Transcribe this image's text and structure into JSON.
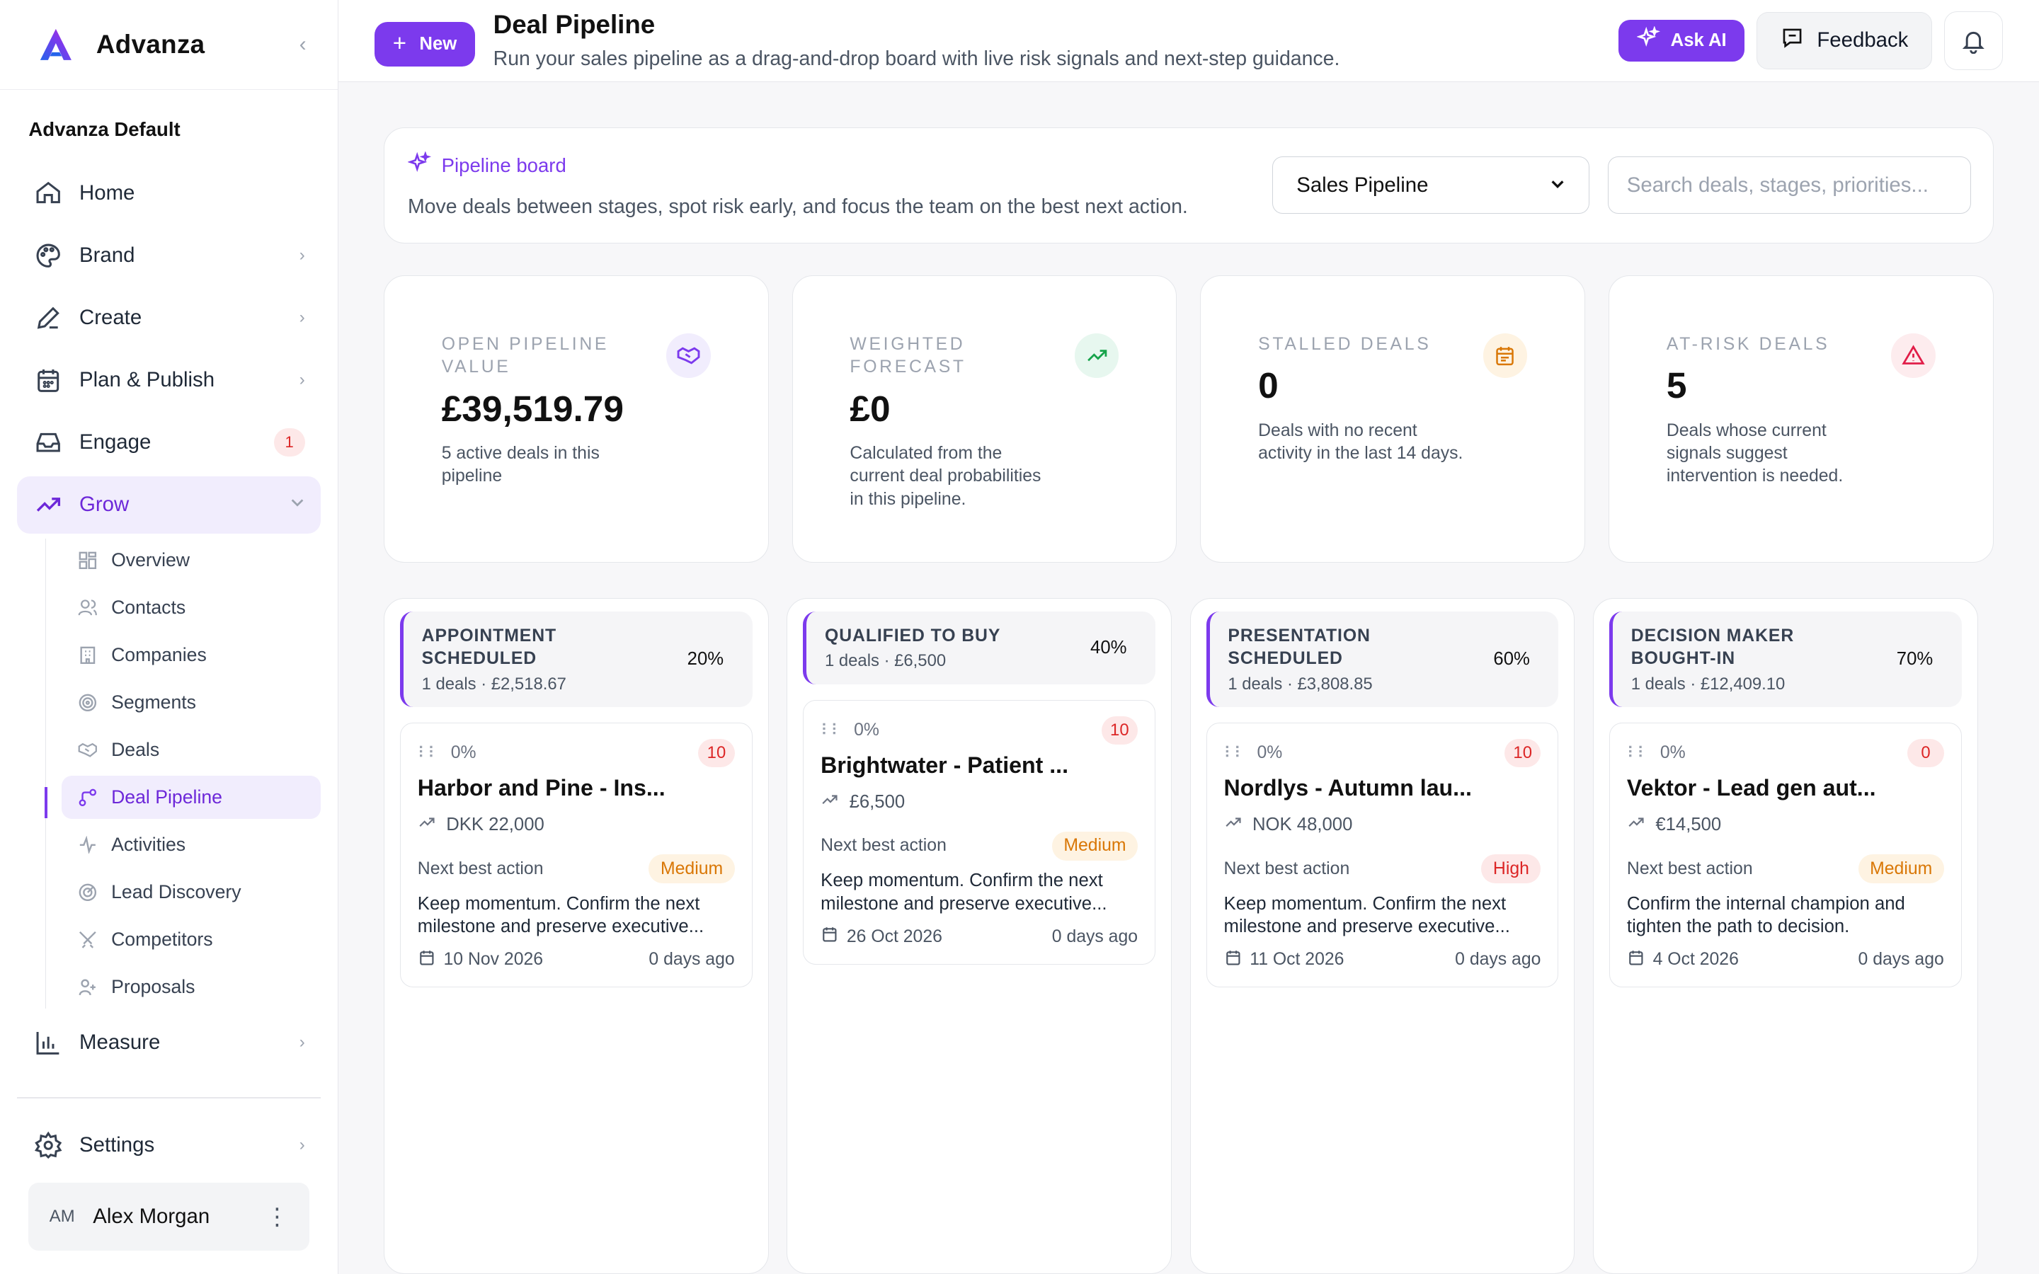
{
  "sidebar": {
    "brand": "Advanza",
    "workspace": "Advanza Default",
    "nav": [
      {
        "label": "Home",
        "icon": "home-icon"
      },
      {
        "label": "Brand",
        "icon": "palette-icon"
      },
      {
        "label": "Create",
        "icon": "pen-icon"
      },
      {
        "label": "Plan & Publish",
        "icon": "calendar-icon"
      },
      {
        "label": "Engage",
        "icon": "inbox-icon",
        "badge": "1"
      },
      {
        "label": "Grow",
        "icon": "trend-icon"
      }
    ],
    "subnav": [
      {
        "label": "Overview"
      },
      {
        "label": "Contacts"
      },
      {
        "label": "Companies"
      },
      {
        "label": "Segments"
      },
      {
        "label": "Deals"
      },
      {
        "label": "Deal Pipeline"
      },
      {
        "label": "Activities"
      },
      {
        "label": "Lead Discovery"
      },
      {
        "label": "Competitors"
      },
      {
        "label": "Proposals"
      }
    ],
    "measure": "Measure",
    "settings": "Settings",
    "user": {
      "initials": "AM",
      "name": "Alex Morgan"
    }
  },
  "topbar": {
    "new_label": "New",
    "title": "Deal Pipeline",
    "subtitle": "Run your sales pipeline as a drag-and-drop board with live risk signals and next-step guidance.",
    "ask_ai": "Ask AI",
    "feedback": "Feedback"
  },
  "board": {
    "label": "Pipeline board",
    "description": "Move deals between stages, spot risk early, and focus the team on the best next action.",
    "pipeline_select": "Sales Pipeline",
    "search_placeholder": "Search deals, stages, priorities..."
  },
  "stats": [
    {
      "label": "OPEN PIPELINE VALUE",
      "value": "£39,519.79",
      "desc": "5 active deals in this pipeline",
      "icon": "handshake-icon",
      "icon_bg": "#f1edfd",
      "icon_color": "#7c3aed"
    },
    {
      "label": "WEIGHTED FORECAST",
      "value": "£0",
      "desc": "Calculated from the current deal probabilities in this pipeline.",
      "icon": "trend-up-icon",
      "icon_bg": "#e7f7ef",
      "icon_color": "#16a34a"
    },
    {
      "label": "STALLED DEALS",
      "value": "0",
      "desc": "Deals with no recent activity in the last 14 days.",
      "icon": "calendar-icon",
      "icon_bg": "#fef3e2",
      "icon_color": "#d97706"
    },
    {
      "label": "AT-RISK DEALS",
      "value": "5",
      "desc": "Deals whose current signals suggest intervention is needed.",
      "icon": "warning-icon",
      "icon_bg": "#fdecee",
      "icon_color": "#e11d48"
    }
  ],
  "columns": [
    {
      "title": "APPOINTMENT SCHEDULED",
      "meta": "1 deals · £2,518.67",
      "pct": "20%",
      "deals": [
        {
          "pct": "0%",
          "score": "10",
          "name": "Harbor and Pine - Ins...",
          "amount": "DKK 22,000",
          "nba_label": "Next best action",
          "priority": "Medium",
          "priority_class": "medium",
          "nba": "Keep momentum. Confirm the next milestone and preserve executive...",
          "date": "10 Nov 2026",
          "ago": "0 days ago"
        }
      ]
    },
    {
      "title": "QUALIFIED TO BUY",
      "meta": "1 deals · £6,500",
      "pct": "40%",
      "deals": [
        {
          "pct": "0%",
          "score": "10",
          "name": "Brightwater - Patient ...",
          "amount": "£6,500",
          "nba_label": "Next best action",
          "priority": "Medium",
          "priority_class": "medium",
          "nba": "Keep momentum. Confirm the next milestone and preserve executive...",
          "date": "26 Oct 2026",
          "ago": "0 days ago"
        }
      ]
    },
    {
      "title": "PRESENTATION SCHEDULED",
      "meta": "1 deals · £3,808.85",
      "pct": "60%",
      "deals": [
        {
          "pct": "0%",
          "score": "10",
          "name": "Nordlys - Autumn lau...",
          "amount": "NOK 48,000",
          "nba_label": "Next best action",
          "priority": "High",
          "priority_class": "high",
          "nba": "Keep momentum. Confirm the next milestone and preserve executive...",
          "date": "11 Oct 2026",
          "ago": "0 days ago"
        }
      ]
    },
    {
      "title": "DECISION MAKER BOUGHT-IN",
      "meta": "1 deals · £12,409.10",
      "pct": "70%",
      "deals": [
        {
          "pct": "0%",
          "score": "0",
          "name": "Vektor - Lead gen aut...",
          "amount": "€14,500",
          "nba_label": "Next best action",
          "priority": "Medium",
          "priority_class": "medium",
          "nba": "Confirm the internal champion and tighten the path to decision.",
          "date": "4 Oct 2026",
          "ago": "0 days ago"
        }
      ]
    }
  ]
}
